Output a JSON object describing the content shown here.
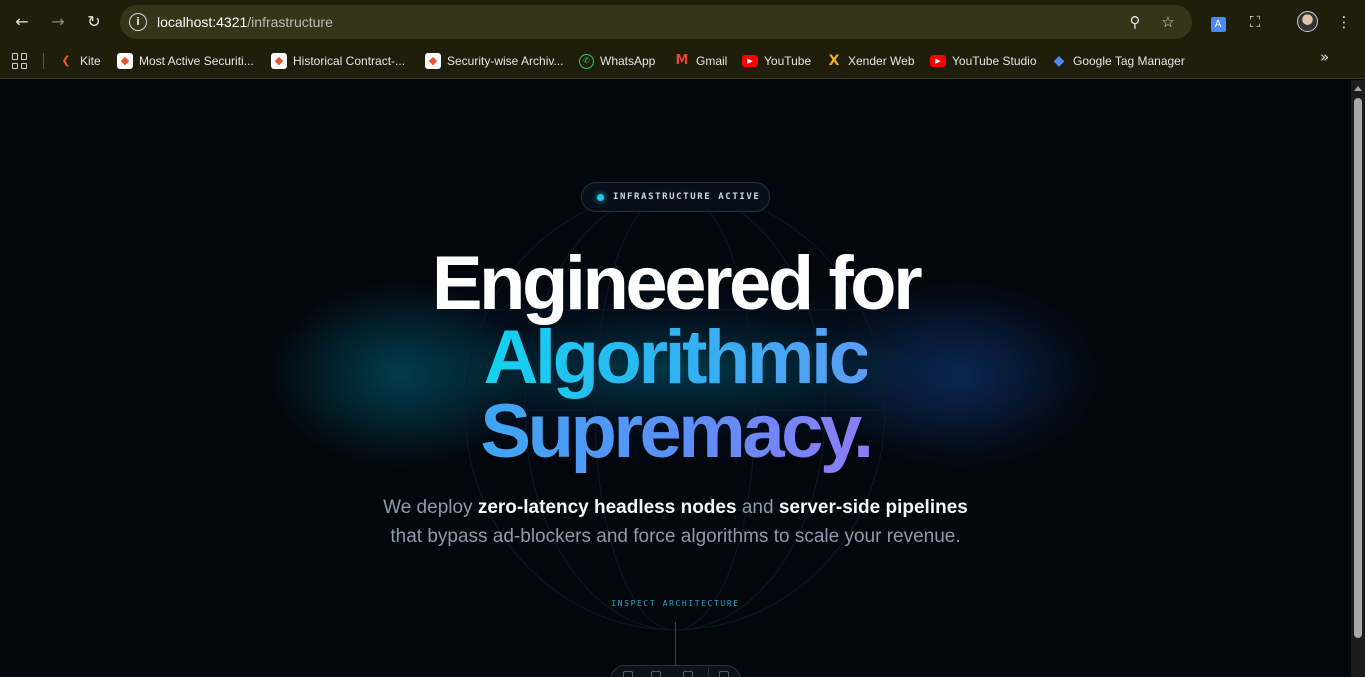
{
  "browser": {
    "url_host": "localhost:4321",
    "url_path": "/infrastructure",
    "bookmarks": [
      {
        "label": "Kite",
        "icon": "kite-icon",
        "color": "#f05a28"
      },
      {
        "label": "Most Active Securiti...",
        "icon": "nse-icon",
        "color": "#e8542c"
      },
      {
        "label": "Historical Contract-...",
        "icon": "nse-icon",
        "color": "#e8542c"
      },
      {
        "label": "Security-wise Archiv...",
        "icon": "nse-icon",
        "color": "#e8542c"
      },
      {
        "label": "WhatsApp",
        "icon": "whatsapp-icon",
        "color": "#25d366"
      },
      {
        "label": "Gmail",
        "icon": "gmail-icon",
        "color": "#ea4335"
      },
      {
        "label": "YouTube",
        "icon": "youtube-icon",
        "color": "#ff0000"
      },
      {
        "label": "Xender Web",
        "icon": "xender-icon",
        "color": "#f5a623"
      },
      {
        "label": "YouTube Studio",
        "icon": "youtube-studio-icon",
        "color": "#ff0000"
      },
      {
        "label": "Google Tag Manager",
        "icon": "tag-manager-icon",
        "color": "#4a8af4"
      }
    ]
  },
  "hero": {
    "badge": "INFRASTRUCTURE ACTIVE",
    "line1": "Engineered for",
    "line2": "Algorithmic",
    "line3": "Supremacy.",
    "sub_pre": "We deploy ",
    "sub_bold1": "zero-latency headless nodes",
    "sub_mid": " and ",
    "sub_bold2": "server-side pipelines",
    "sub_line2": "that bypass ad-blockers and force algorithms to scale your revenue.",
    "inspect": "INSPECT ARCHITECTURE"
  },
  "colors": {
    "accent_cyan": "#14d2f0",
    "accent_violet": "#8e7cf7",
    "background": "#03060c"
  }
}
